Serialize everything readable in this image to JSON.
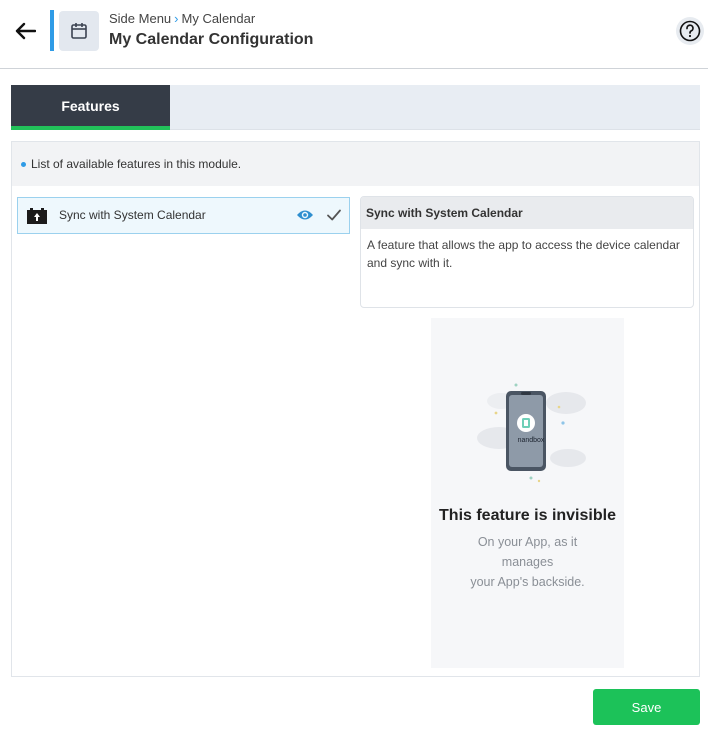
{
  "header": {
    "breadcrumb": [
      "Side Menu",
      "My Calendar"
    ],
    "title": "My Calendar Configuration",
    "icons": {
      "back": "arrow-left-icon",
      "module": "calendar-icon",
      "help": "question-circle-icon"
    }
  },
  "tabs": [
    {
      "label": "Features",
      "active": true
    }
  ],
  "panel": {
    "info_text": "List of available features in this module.",
    "features": [
      {
        "label": "Sync with System Calendar",
        "icon": "calendar-sync-icon",
        "visible_icon": "eye-icon",
        "enabled": true
      }
    ],
    "detail": {
      "title": "Sync with System Calendar",
      "description": "A feature that allows the app to access the device calendar and sync with it."
    },
    "preview": {
      "device_brand": "nandbox",
      "title": "This feature is invisible",
      "subtitle_lines": [
        "On your App, as it",
        "manages",
        "your App's backside."
      ]
    }
  },
  "footer": {
    "save_label": "Save"
  },
  "colors": {
    "accent_blue": "#2f9be6",
    "tab_dark": "#353c47",
    "green": "#1cc259"
  }
}
